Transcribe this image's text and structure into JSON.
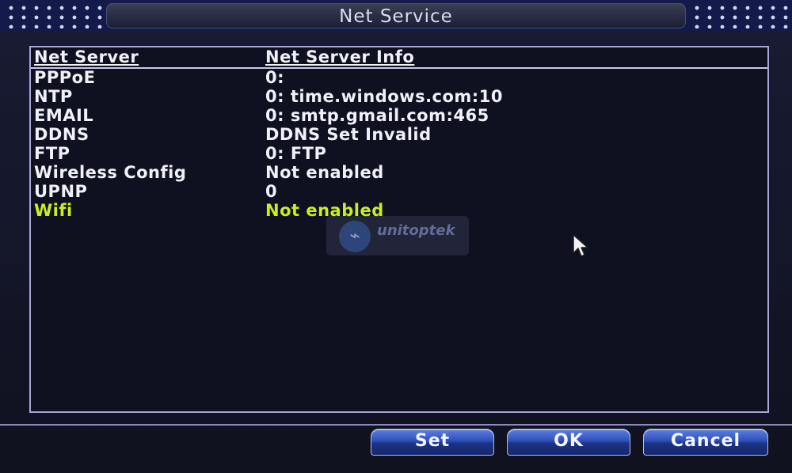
{
  "window": {
    "title": "Net Service"
  },
  "table": {
    "headers": [
      "Net Server",
      "Net Server Info"
    ],
    "rows": [
      {
        "server": "PPPoE",
        "info": "0:"
      },
      {
        "server": "NTP",
        "info": "0: time.windows.com:10"
      },
      {
        "server": "EMAIL",
        "info": "0: smtp.gmail.com:465"
      },
      {
        "server": "DDNS",
        "info": "DDNS Set Invalid"
      },
      {
        "server": "FTP",
        "info": "0: FTP"
      },
      {
        "server": "Wireless Config",
        "info": "Not enabled"
      },
      {
        "server": "UPNP",
        "info": "0"
      },
      {
        "server": "Wifi",
        "info": "Not enabled"
      }
    ],
    "selected_index": 7
  },
  "buttons": {
    "set_label": "Set",
    "ok_label": "OK",
    "cancel_label": "Cancel"
  },
  "watermark": {
    "text": "unitoptek"
  },
  "colors": {
    "selected_row": "#c8f01e",
    "text": "#f0f0f8",
    "button": "#2f4fb8"
  },
  "icons": {
    "cursor": "mouse-pointer-icon"
  }
}
